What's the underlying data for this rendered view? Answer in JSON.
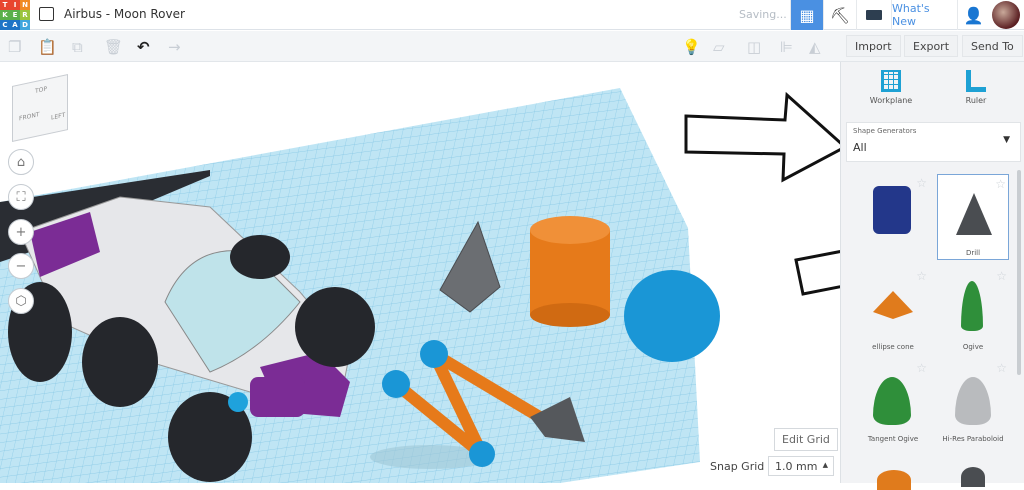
{
  "header": {
    "logo_letters": [
      "T",
      "I",
      "N",
      "K",
      "E",
      "R",
      "C",
      "A",
      "D"
    ],
    "title": "Airbus - Moon Rover",
    "status": "Saving...",
    "whats_new": "What's New"
  },
  "toolbar": {
    "import": "Import",
    "export": "Export",
    "send_to": "Send To"
  },
  "viewcube": {
    "top": "TOP",
    "front": "FRONT",
    "side": "LEFT"
  },
  "panel": {
    "workplane": "Workplane",
    "ruler": "Ruler",
    "category_label": "Shape Generators",
    "category_value": "All",
    "shapes": [
      {
        "label": ""
      },
      {
        "label": "Drill"
      },
      {
        "label": "ellipse cone"
      },
      {
        "label": "Ogive"
      },
      {
        "label": "Tangent Ogive"
      },
      {
        "label": "Hi-Res Paraboloid"
      }
    ]
  },
  "grid": {
    "edit_grid": "Edit Grid",
    "snap_label": "Snap Grid",
    "snap_value": "1.0 mm"
  },
  "colors": {
    "accent": "#4a90e2",
    "grid": "#a9dcef"
  }
}
